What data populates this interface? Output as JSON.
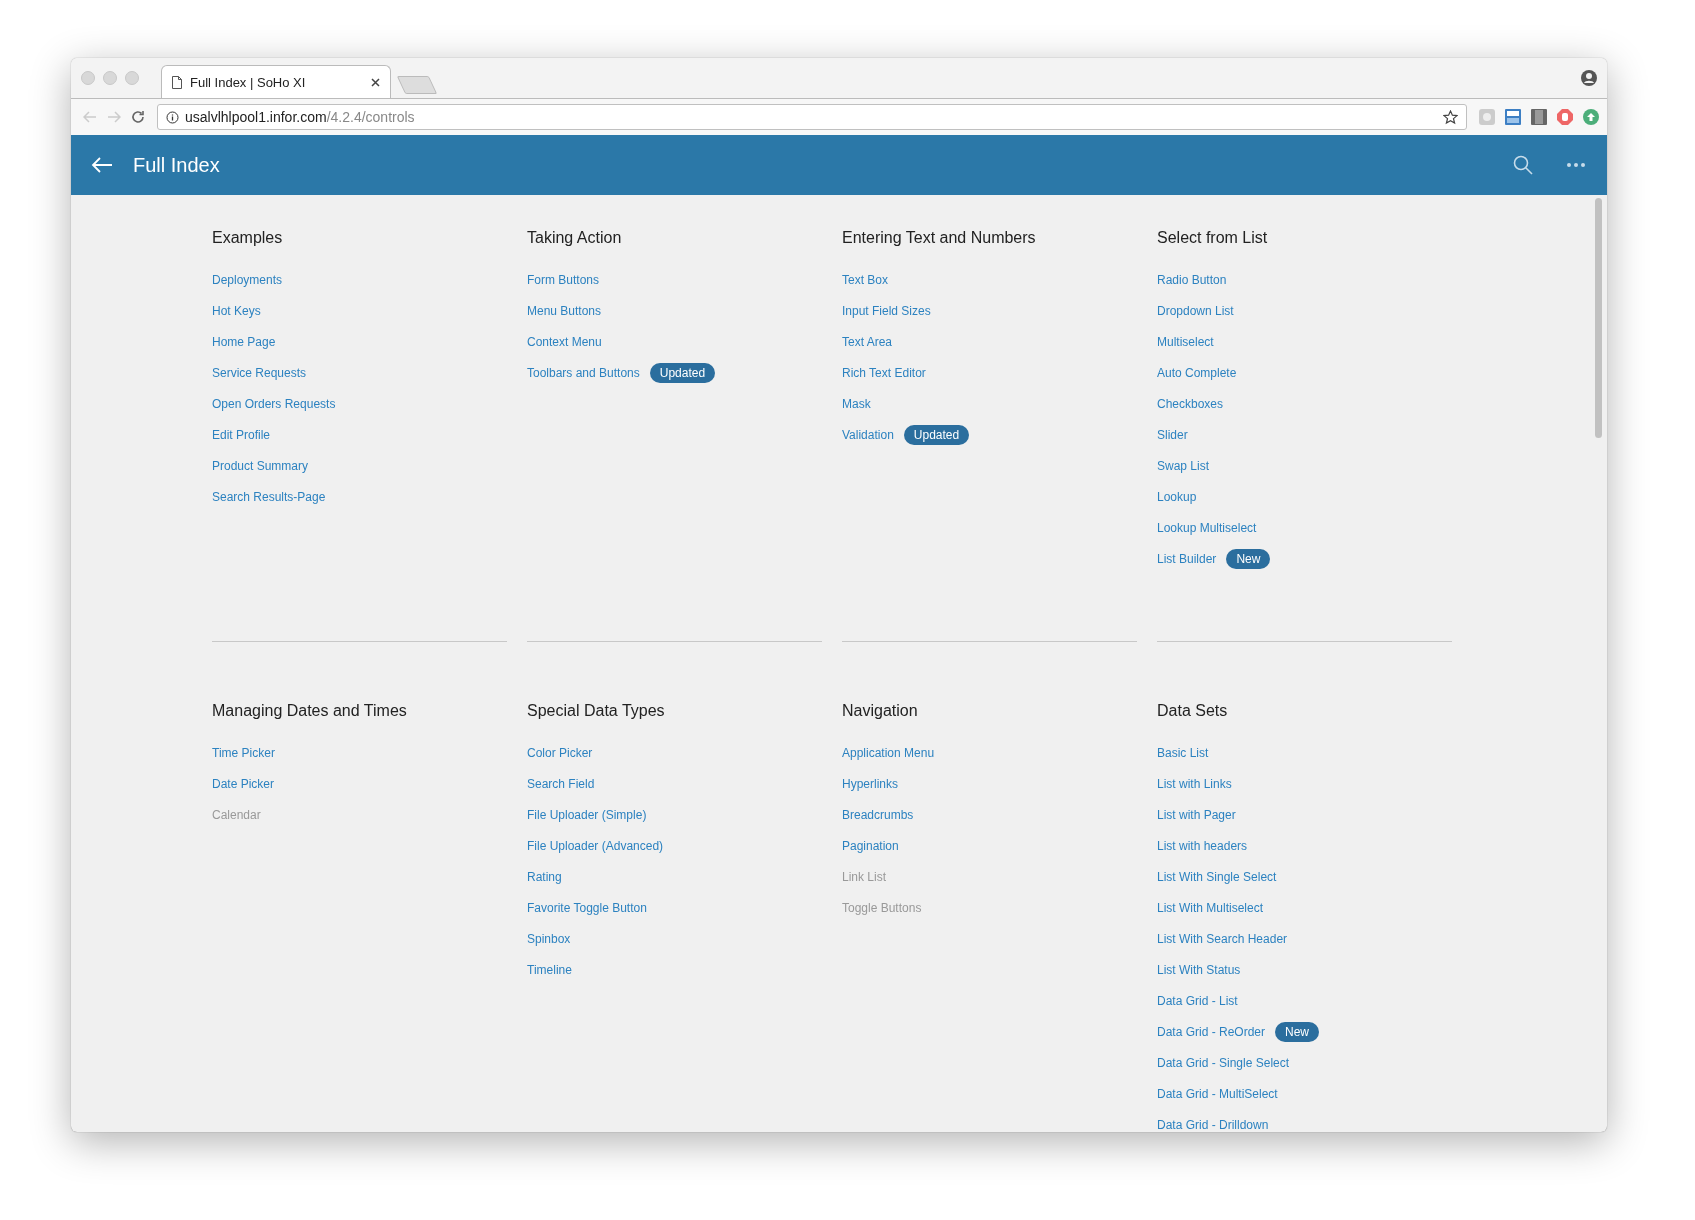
{
  "browser": {
    "tab_title": "Full Index | SoHo XI",
    "url_host": "usalvlhlpool1.infor.com",
    "url_path": "/4.2.4/controls"
  },
  "header": {
    "title": "Full Index"
  },
  "rows": [
    {
      "sections": [
        {
          "heading": "Examples",
          "items": [
            {
              "label": "Deployments",
              "disabled": false
            },
            {
              "label": "Hot Keys",
              "disabled": false
            },
            {
              "label": "Home Page",
              "disabled": false
            },
            {
              "label": "Service Requests",
              "disabled": false
            },
            {
              "label": "Open Orders Requests",
              "disabled": false
            },
            {
              "label": "Edit Profile",
              "disabled": false
            },
            {
              "label": "Product Summary",
              "disabled": false
            },
            {
              "label": "Search Results-Page",
              "disabled": false
            }
          ]
        },
        {
          "heading": "Taking Action",
          "items": [
            {
              "label": "Form Buttons",
              "disabled": false
            },
            {
              "label": "Menu Buttons",
              "disabled": false
            },
            {
              "label": "Context Menu",
              "disabled": false
            },
            {
              "label": "Toolbars and Buttons",
              "disabled": false,
              "badge": "Updated"
            }
          ]
        },
        {
          "heading": "Entering Text and Numbers",
          "items": [
            {
              "label": "Text Box",
              "disabled": false
            },
            {
              "label": "Input Field Sizes",
              "disabled": false
            },
            {
              "label": "Text Area",
              "disabled": false
            },
            {
              "label": "Rich Text Editor",
              "disabled": false
            },
            {
              "label": "Mask",
              "disabled": false
            },
            {
              "label": "Validation",
              "disabled": false,
              "badge": "Updated"
            }
          ]
        },
        {
          "heading": "Select from List",
          "items": [
            {
              "label": "Radio Button",
              "disabled": false
            },
            {
              "label": "Dropdown List",
              "disabled": false
            },
            {
              "label": "Multiselect",
              "disabled": false
            },
            {
              "label": "Auto Complete",
              "disabled": false
            },
            {
              "label": "Checkboxes",
              "disabled": false
            },
            {
              "label": "Slider",
              "disabled": false
            },
            {
              "label": "Swap List",
              "disabled": false
            },
            {
              "label": "Lookup",
              "disabled": false
            },
            {
              "label": "Lookup Multiselect",
              "disabled": false
            },
            {
              "label": "List Builder",
              "disabled": false,
              "badge": "New"
            }
          ]
        }
      ]
    },
    {
      "sections": [
        {
          "heading": "Managing Dates and Times",
          "items": [
            {
              "label": "Time Picker",
              "disabled": false
            },
            {
              "label": "Date Picker",
              "disabled": false
            },
            {
              "label": "Calendar",
              "disabled": true
            }
          ]
        },
        {
          "heading": "Special Data Types",
          "items": [
            {
              "label": "Color Picker",
              "disabled": false
            },
            {
              "label": "Search Field",
              "disabled": false
            },
            {
              "label": "File Uploader (Simple)",
              "disabled": false
            },
            {
              "label": "File Uploader (Advanced)",
              "disabled": false
            },
            {
              "label": "Rating",
              "disabled": false
            },
            {
              "label": "Favorite Toggle Button",
              "disabled": false
            },
            {
              "label": "Spinbox",
              "disabled": false
            },
            {
              "label": "Timeline",
              "disabled": false
            }
          ]
        },
        {
          "heading": "Navigation",
          "items": [
            {
              "label": "Application Menu",
              "disabled": false
            },
            {
              "label": "Hyperlinks",
              "disabled": false
            },
            {
              "label": "Breadcrumbs",
              "disabled": false
            },
            {
              "label": "Pagination",
              "disabled": false
            },
            {
              "label": "Link List",
              "disabled": true
            },
            {
              "label": "Toggle Buttons",
              "disabled": true
            }
          ]
        },
        {
          "heading": "Data Sets",
          "items": [
            {
              "label": "Basic List",
              "disabled": false
            },
            {
              "label": "List with Links",
              "disabled": false
            },
            {
              "label": "List with Pager",
              "disabled": false
            },
            {
              "label": "List with headers",
              "disabled": false
            },
            {
              "label": "List With Single Select",
              "disabled": false
            },
            {
              "label": "List With Multiselect",
              "disabled": false
            },
            {
              "label": "List With Search Header",
              "disabled": false
            },
            {
              "label": "List With Status",
              "disabled": false
            },
            {
              "label": "Data Grid - List",
              "disabled": false
            },
            {
              "label": "Data Grid - ReOrder",
              "disabled": false,
              "badge": "New"
            },
            {
              "label": "Data Grid - Single Select",
              "disabled": false
            },
            {
              "label": "Data Grid - MultiSelect",
              "disabled": false
            },
            {
              "label": "Data Grid - Drilldown",
              "disabled": false
            }
          ]
        }
      ]
    }
  ]
}
